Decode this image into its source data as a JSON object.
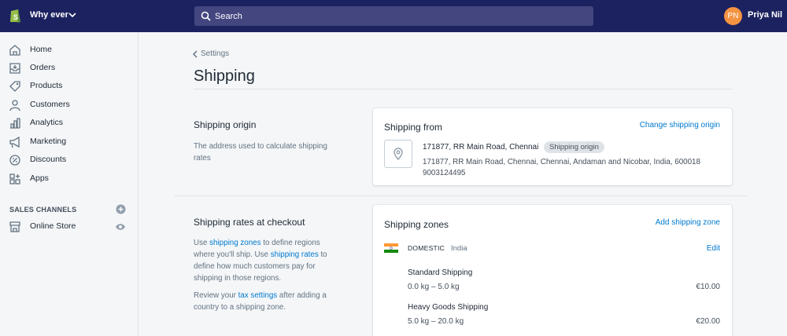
{
  "topbar": {
    "store_name": "Why ever",
    "search_placeholder": "Search",
    "avatar_initials": "PN",
    "user_name": "Priya Nil",
    "bg_color": "#1c2260"
  },
  "sidebar": {
    "items": [
      {
        "label": "Home",
        "icon": "home-icon"
      },
      {
        "label": "Orders",
        "icon": "orders-icon"
      },
      {
        "label": "Products",
        "icon": "tag-icon"
      },
      {
        "label": "Customers",
        "icon": "person-icon"
      },
      {
        "label": "Analytics",
        "icon": "bar-chart-icon"
      },
      {
        "label": "Marketing",
        "icon": "megaphone-icon"
      },
      {
        "label": "Discounts",
        "icon": "discount-icon"
      },
      {
        "label": "Apps",
        "icon": "apps-icon"
      }
    ],
    "sales_channels_title": "SALES CHANNELS",
    "channels": [
      {
        "label": "Online Store",
        "icon": "store-icon"
      }
    ]
  },
  "page": {
    "breadcrumb": "Settings",
    "title": "Shipping"
  },
  "origin_section": {
    "title": "Shipping origin",
    "description": "The address used to calculate shipping rates",
    "card_title": "Shipping from",
    "action": "Change shipping origin",
    "address_name": "171877, RR Main Road, Chennai",
    "badge": "Shipping origin",
    "address_full": "171877, RR Main Road, Chennai, Chennai, Andaman and Nicobar, India, 600018",
    "phone": "9003124495"
  },
  "rates_section": {
    "title": "Shipping rates at checkout",
    "desc1_pre": "Use ",
    "desc1_link1": "shipping zones",
    "desc1_mid1": " to define regions where you'll ship. Use ",
    "desc1_link2": "shipping rates",
    "desc1_post": " to define how much customers pay for shipping in those regions.",
    "desc2_pre": "Review your ",
    "desc2_link": "tax settings",
    "desc2_post": " after adding a country to a shipping zone.",
    "card_title": "Shipping zones",
    "action": "Add shipping zone",
    "zone_type": "DOMESTIC",
    "zone_country": "India",
    "zone_edit": "Edit",
    "rates": [
      {
        "name": "Standard Shipping",
        "range": "0.0 kg – 5.0 kg",
        "price": "€10.00"
      },
      {
        "name": "Heavy Goods Shipping",
        "range": "5.0 kg – 20.0 kg",
        "price": "€20.00"
      }
    ]
  },
  "colors": {
    "link": "#007ace",
    "avatar": "#f49342",
    "search_bg": "#43467f",
    "page_bg": "#f4f6f8"
  }
}
